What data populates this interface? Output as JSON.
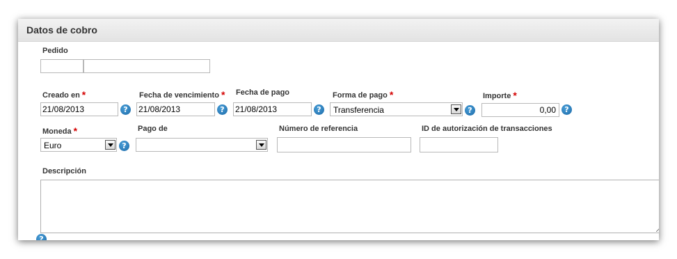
{
  "panel": {
    "title": "Datos de cobro"
  },
  "pedido": {
    "label": "Pedido",
    "value1": "",
    "value2": ""
  },
  "creado_en": {
    "label": "Creado en",
    "required_mark": "*",
    "value": "21/08/2013"
  },
  "fecha_vencimiento": {
    "label": "Fecha de vencimiento",
    "required_mark": "*",
    "value": "21/08/2013"
  },
  "fecha_pago": {
    "label": "Fecha de pago",
    "value": "21/08/2013"
  },
  "forma_pago": {
    "label": "Forma de pago",
    "required_mark": "*",
    "value": "Transferencia"
  },
  "importe": {
    "label": "Importe",
    "required_mark": "*",
    "value": "0,00"
  },
  "moneda": {
    "label": "Moneda",
    "required_mark": "*",
    "value": "Euro"
  },
  "pago_de": {
    "label": "Pago de",
    "value": ""
  },
  "numero_referencia": {
    "label": "Número de referencia",
    "value": ""
  },
  "id_autorizacion": {
    "label": "ID de autorización de transacciones",
    "value": ""
  },
  "descripcion": {
    "label": "Descripción",
    "value": ""
  },
  "help": {
    "glyph": "?",
    "icon": "help-icon",
    "color": "#1f70b0"
  },
  "colors": {
    "required": "#d40000",
    "header_bg": "#e8e8e8"
  }
}
